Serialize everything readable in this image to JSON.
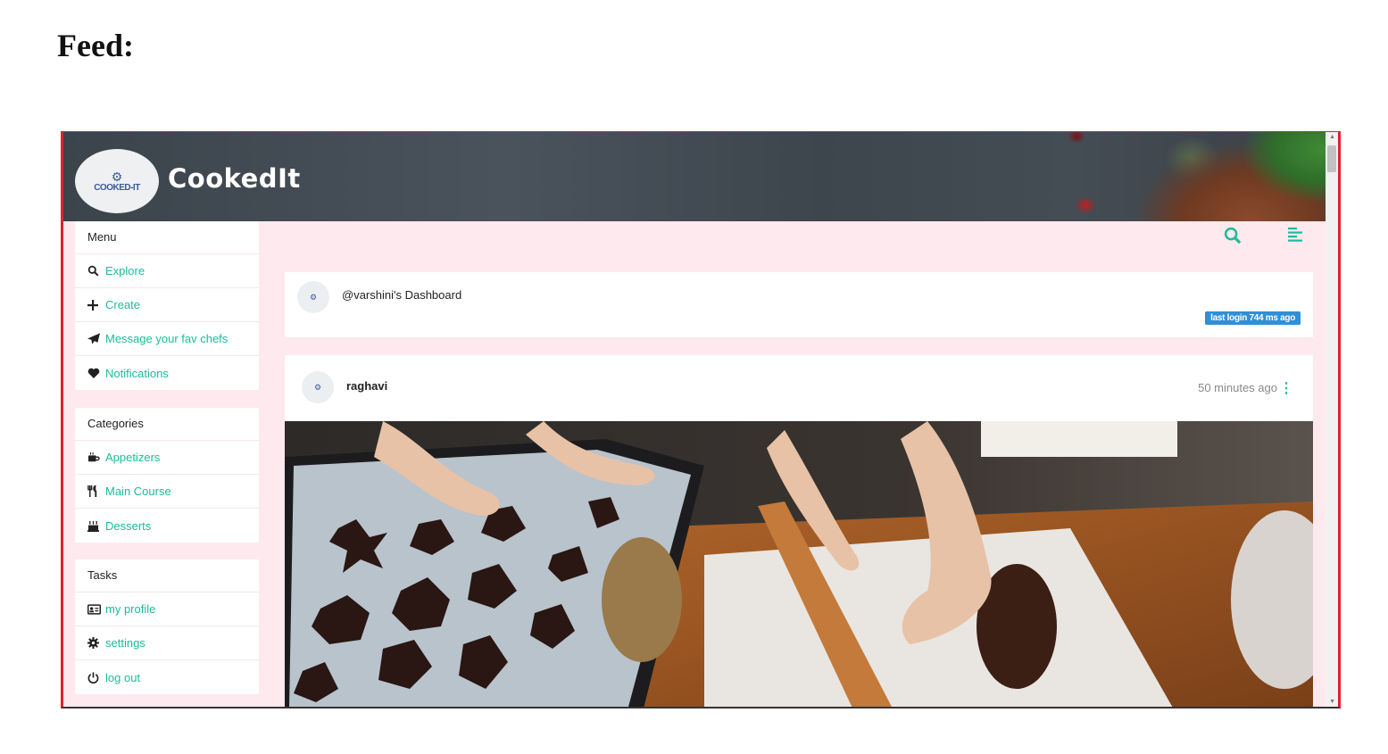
{
  "doc": {
    "heading": "Feed:"
  },
  "app": {
    "brand": "CookedIt",
    "logo_text": "COOKED-IT"
  },
  "sidebar": {
    "menu": {
      "title": "Menu",
      "items": [
        {
          "label": "Explore",
          "icon": "search-icon"
        },
        {
          "label": "Create",
          "icon": "plus-icon"
        },
        {
          "label": "Message your fav chefs",
          "icon": "paper-plane-icon"
        },
        {
          "label": "Notifications",
          "icon": "heart-icon"
        }
      ]
    },
    "categories": {
      "title": "Categories",
      "items": [
        {
          "label": "Appetizers",
          "icon": "coffee-cup-icon"
        },
        {
          "label": "Main Course",
          "icon": "utensils-icon"
        },
        {
          "label": "Desserts",
          "icon": "cake-icon"
        }
      ]
    },
    "tasks": {
      "title": "Tasks",
      "items": [
        {
          "label": "my profile",
          "icon": "id-card-icon"
        },
        {
          "label": "settings",
          "icon": "gear-icon"
        },
        {
          "label": "log out",
          "icon": "power-icon"
        }
      ]
    }
  },
  "dashboard": {
    "title": "@varshini's Dashboard",
    "badge": "last login 744 ms ago"
  },
  "post": {
    "user": "raghavi",
    "time": "50 minutes ago"
  },
  "colors": {
    "accent": "#1abc9c",
    "background": "#fde9ee",
    "badge": "#2f8fd8",
    "border": "#d9252f"
  }
}
